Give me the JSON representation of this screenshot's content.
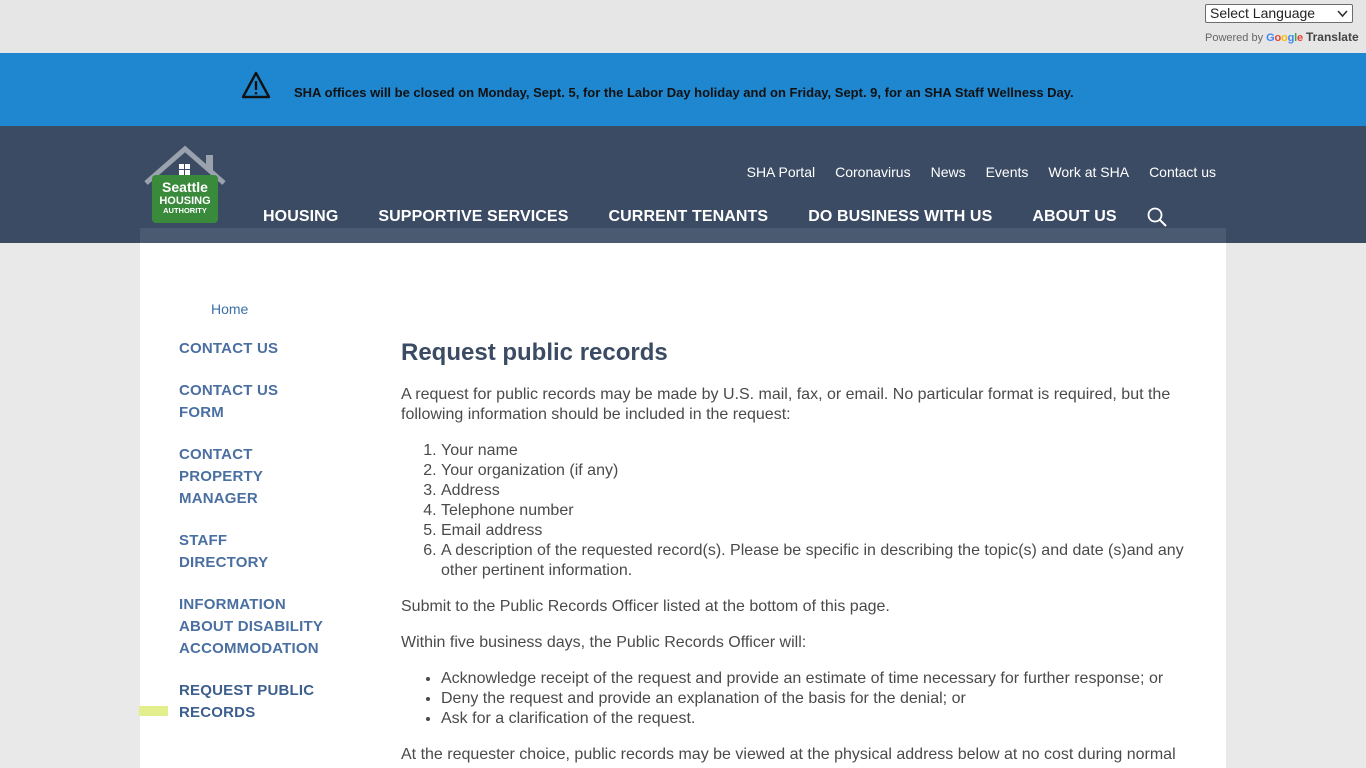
{
  "translate": {
    "select_label": "Select Language",
    "powered_by": "Powered by",
    "google": "Google",
    "translate_label": "Translate"
  },
  "alert": {
    "icon": "warning-icon",
    "text": "SHA offices will be closed on Monday, Sept. 5, for the Labor Day holiday and on Friday, Sept. 9, for an SHA Staff Wellness Day."
  },
  "header": {
    "logo": {
      "line1": "Seattle",
      "line2": "HOUSING",
      "line3": "AUTHORITY",
      "color": "#3a8a3c"
    },
    "utility_nav": [
      "SHA Portal",
      "Coronavirus",
      "News",
      "Events",
      "Work at SHA",
      "Contact us"
    ],
    "main_nav": [
      "HOUSING",
      "SUPPORTIVE SERVICES",
      "CURRENT TENANTS",
      "DO BUSINESS WITH US",
      "ABOUT US"
    ],
    "search_icon": "search-icon"
  },
  "breadcrumb": {
    "home": "Home"
  },
  "sidebar": {
    "items": [
      {
        "label": "CONTACT US"
      },
      {
        "label": "CONTACT US FORM"
      },
      {
        "label": "CONTACT PROPERTY MANAGER"
      },
      {
        "label": "STAFF DIRECTORY"
      },
      {
        "label": "INFORMATION ABOUT DISABILITY ACCOMMODATION"
      },
      {
        "label": "REQUEST PUBLIC RECORDS",
        "active": true
      }
    ]
  },
  "main": {
    "title": "Request public records",
    "intro": "A request for public records may be made by  U.S. mail, fax, or email. No particular format is required, but the following information should be included in the request:",
    "required_info": [
      "Your name",
      "Your organization (if any)",
      "Address",
      "Telephone number",
      "Email address",
      "A description of the requested record(s). Please be specific in describing the topic(s) and date (s)and any other pertinent information."
    ],
    "submit_text": "Submit to the Public Records Officer listed at the bottom of this page.",
    "within_text": "Within five business days, the Public Records Officer will:",
    "officer_actions": [
      "Acknowledge receipt of the request and provide an estimate of time necessary for further response; or",
      "Deny the request and provide an explanation of the basis for the denial; or",
      "Ask for a clarification of the request."
    ],
    "requester_text": "At the requester choice, public records may be viewed at the physical address below at no cost during normal"
  },
  "colors": {
    "alert_bg": "#1e87d0",
    "header_bg": "#3b4b63",
    "link": "#4a6fa0",
    "active_marker": "#e3ee8c"
  }
}
